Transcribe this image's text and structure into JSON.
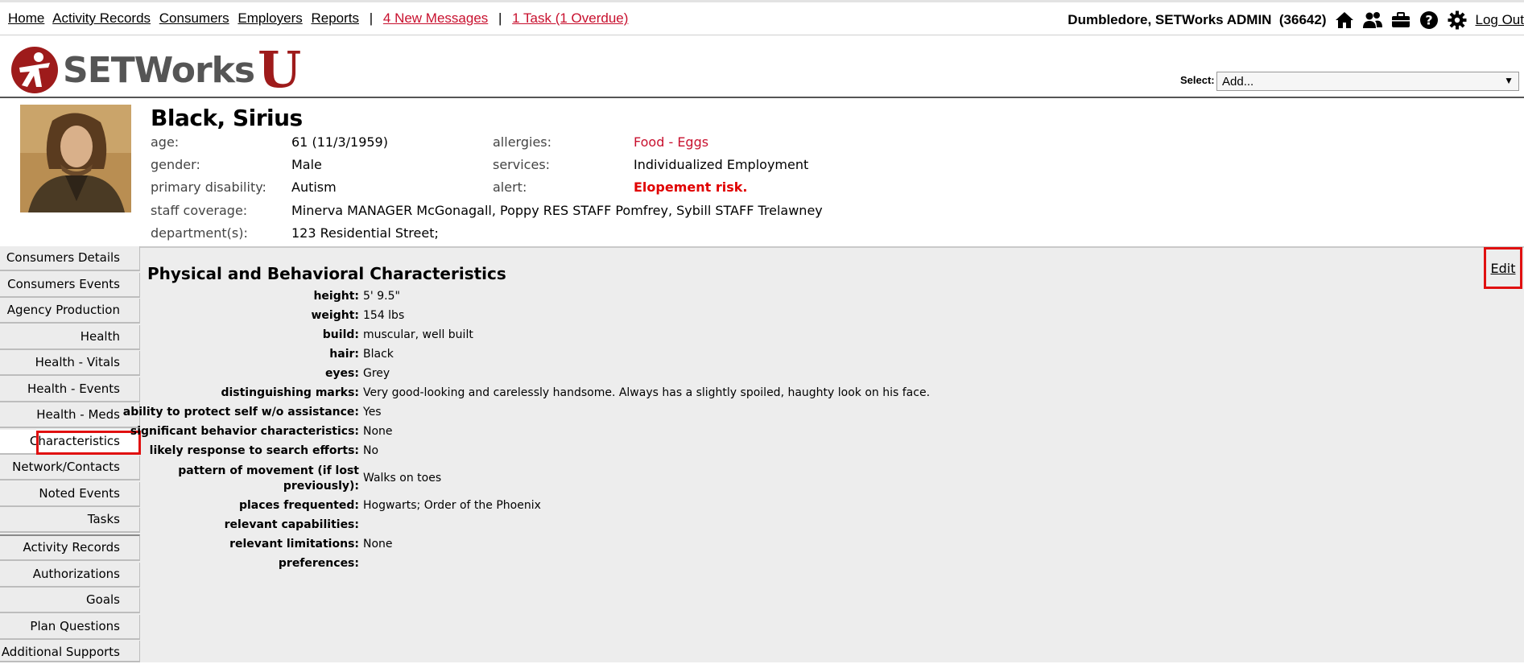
{
  "topnav": {
    "links": [
      "Home",
      "Activity Records",
      "Consumers",
      "Employers",
      "Reports"
    ],
    "messages": "4 New Messages",
    "tasks": "1 Task (1 Overdue)"
  },
  "user": {
    "name": "Dumbledore, SETWorks ADMIN",
    "id": "(36642)",
    "logout": "Log Out",
    "icons": [
      "home-icon",
      "users-icon",
      "briefcase-icon",
      "help-icon",
      "gear-icon"
    ]
  },
  "logo": {
    "text": "SETWorks",
    "u": "U"
  },
  "select": {
    "label": "Select:",
    "value": "Add..."
  },
  "consumer": {
    "name": "Black, Sirius",
    "fields": {
      "age_label": "age:",
      "age": "61 (11/3/1959)",
      "gender_label": "gender:",
      "gender": "Male",
      "disability_label": "primary disability:",
      "disability": "Autism",
      "coverage_label": "staff coverage:",
      "coverage": "Minerva MANAGER McGonagall, Poppy RES STAFF Pomfrey, Sybill STAFF Trelawney",
      "department_label": "department(s):",
      "department": "123 Residential Street;",
      "allergies_label": "allergies:",
      "allergies": "Food - Eggs",
      "services_label": "services:",
      "services": "Individualized Employment",
      "alert_label": "alert:",
      "alert": "Elopement risk."
    }
  },
  "sidenav": {
    "items": [
      "Consumers Details",
      "Consumers Events",
      "Agency Production",
      "Health",
      "Health - Vitals",
      "Health - Events",
      "Health - Meds",
      "Characteristics",
      "Network/Contacts",
      "Noted Events",
      "Tasks",
      "Activity Records",
      "Authorizations",
      "Goals",
      "Plan Questions",
      "Additional Supports"
    ],
    "active": "Characteristics"
  },
  "section": {
    "title": "Physical and Behavioral Characteristics",
    "edit": "Edit",
    "rows": [
      {
        "label": "height:",
        "value": "5' 9.5\""
      },
      {
        "label": "weight:",
        "value": "154 lbs"
      },
      {
        "label": "build:",
        "value": "muscular, well built"
      },
      {
        "label": "hair:",
        "value": "Black"
      },
      {
        "label": "eyes:",
        "value": "Grey"
      },
      {
        "label": "distinguishing marks:",
        "value": "Very good-looking and carelessly handsome. Always has a slightly spoiled, haughty look on his face."
      },
      {
        "label": "ability to protect self w/o assistance:",
        "value": "Yes"
      },
      {
        "label": "significant behavior characteristics:",
        "value": "None"
      },
      {
        "label": "likely response to search efforts:",
        "value": "No"
      },
      {
        "label": "pattern of movement (if lost previously):",
        "value": "Walks on toes"
      },
      {
        "label": "places frequented:",
        "value": "Hogwarts; Order of the Phoenix"
      },
      {
        "label": "relevant capabilities:",
        "value": ""
      },
      {
        "label": "relevant limitations:",
        "value": "None"
      },
      {
        "label": "preferences:",
        "value": ""
      }
    ]
  }
}
